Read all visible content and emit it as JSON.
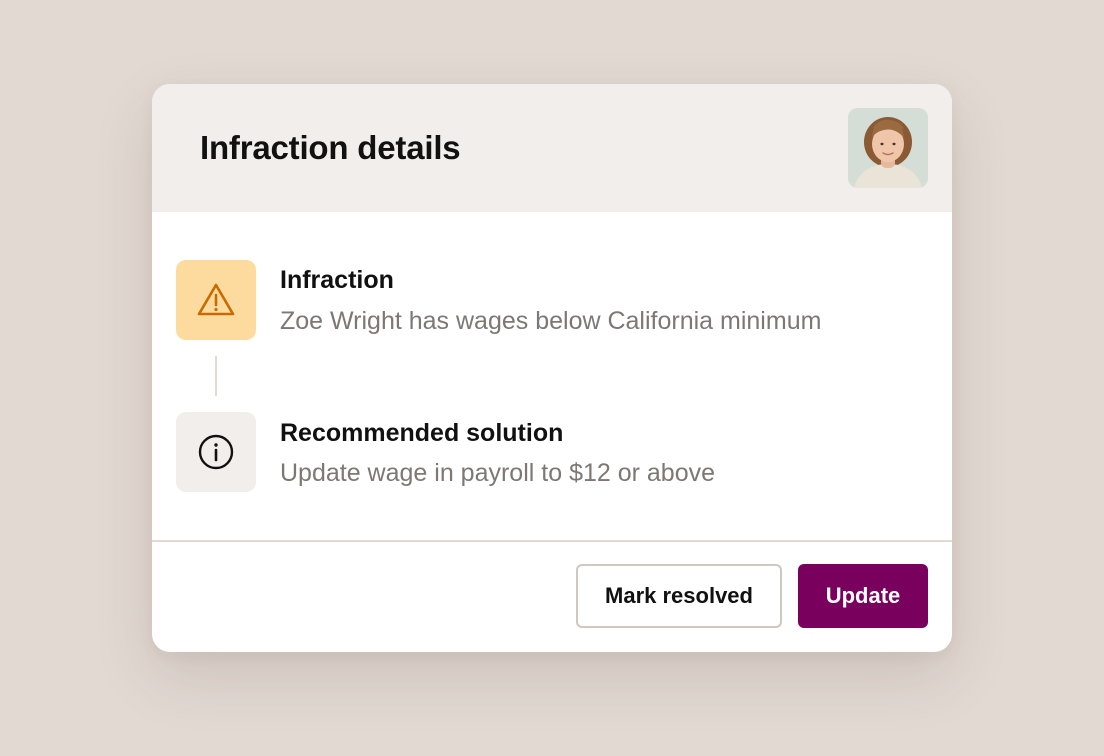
{
  "dialog": {
    "title": "Infraction details",
    "avatar_alt": "avatar"
  },
  "items": [
    {
      "title": "Infraction",
      "description": "Zoe Wright has wages below California minimum",
      "icon": "warning-triangle-icon",
      "icon_bg": "#fddb9e",
      "icon_color": "#c86a00"
    },
    {
      "title": "Recommended solution",
      "description": "Update wage in payroll to $12 or above",
      "icon": "info-circle-icon",
      "icon_bg": "#f1eeeb",
      "icon_color": "#111111"
    }
  ],
  "actions": {
    "secondary_label": "Mark resolved",
    "primary_label": "Update"
  },
  "colors": {
    "background": "#e2d9d3",
    "header_bg": "#f1eeeb",
    "primary": "#7a005d",
    "muted_text": "#7e7773"
  }
}
